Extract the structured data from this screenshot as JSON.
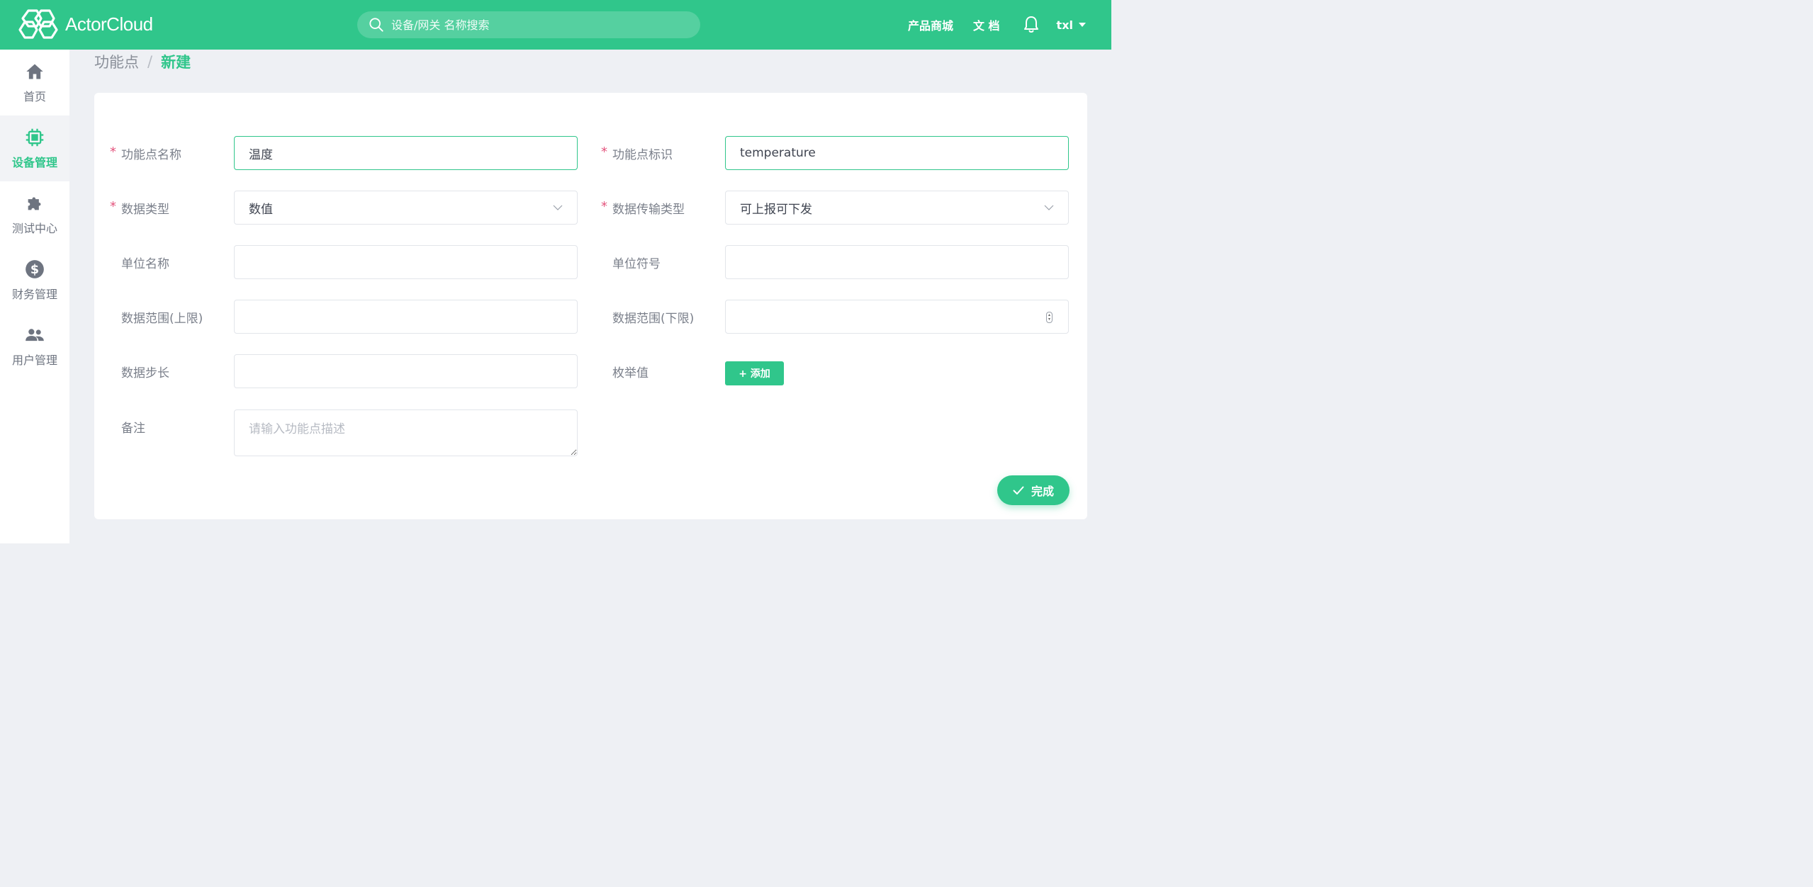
{
  "brand": {
    "logo_text": "ActorCloud",
    "primary_color": "#30c68b"
  },
  "search": {
    "placeholder": "设备/网关 名称搜索",
    "icon": "search-icon"
  },
  "topnav": {
    "shop": "产品商城",
    "docs": "文 档",
    "bell_icon": "bell-icon",
    "user": "txl"
  },
  "sidebar": {
    "items": [
      {
        "label": "首页",
        "icon": "home-icon",
        "active": false
      },
      {
        "label": "设备管理",
        "icon": "chip-icon",
        "active": true
      },
      {
        "label": "测试中心",
        "icon": "puzzle-icon",
        "active": false
      },
      {
        "label": "财务管理",
        "icon": "dollar-icon",
        "active": false
      },
      {
        "label": "用户管理",
        "icon": "users-icon",
        "active": false
      }
    ]
  },
  "breadcrumb": {
    "parent": "功能点",
    "separator": "/",
    "current": "新建"
  },
  "form": {
    "required_mark": "*",
    "name": {
      "label": "功能点名称",
      "value": "温度"
    },
    "identifier": {
      "label": "功能点标识",
      "value": "temperature"
    },
    "data_type": {
      "label": "数据类型",
      "value": "数值"
    },
    "transfer_type": {
      "label": "数据传输类型",
      "value": "可上报可下发"
    },
    "unit_name": {
      "label": "单位名称",
      "value": ""
    },
    "unit_symbol": {
      "label": "单位符号",
      "value": ""
    },
    "range_max": {
      "label": "数据范围(上限)",
      "value": ""
    },
    "range_min": {
      "label": "数据范围(下限)",
      "value": ""
    },
    "step": {
      "label": "数据步长",
      "value": ""
    },
    "enum": {
      "label": "枚举值",
      "add_button": "+ 添加"
    },
    "remark": {
      "label": "备注",
      "placeholder": "请输入功能点描述"
    }
  },
  "actions": {
    "done": "完成"
  }
}
